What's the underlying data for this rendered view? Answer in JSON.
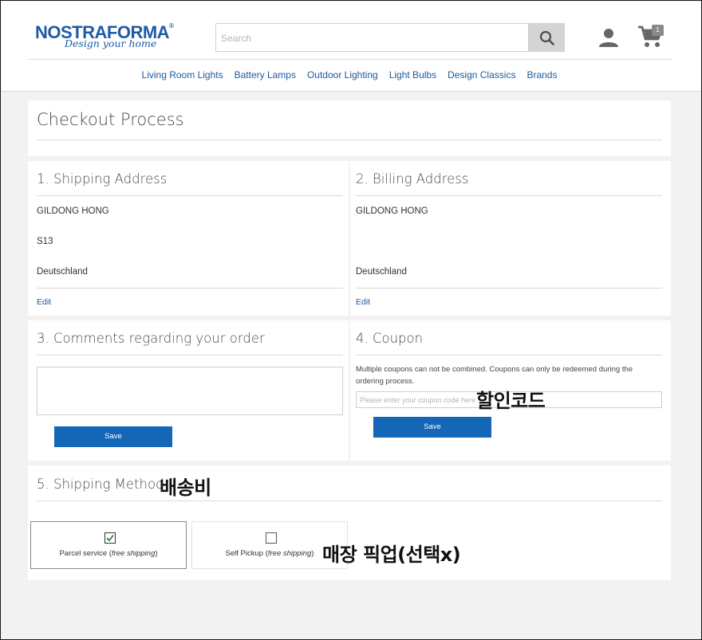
{
  "header": {
    "logo_main": "NOSTRAFORMA",
    "logo_tm": "®",
    "logo_tagline": "Design your home",
    "search_placeholder": "Search",
    "cart_count": "1",
    "icons": {
      "search": "search-icon",
      "user": "user-icon",
      "cart": "cart-icon"
    }
  },
  "nav": {
    "items": [
      {
        "label": "Living Room Lights"
      },
      {
        "label": "Battery Lamps"
      },
      {
        "label": "Outdoor Lighting"
      },
      {
        "label": "Light Bulbs"
      },
      {
        "label": "Design Classics"
      },
      {
        "label": "Brands"
      }
    ]
  },
  "page": {
    "title": "Checkout Process"
  },
  "shipping_address": {
    "title": "1. Shipping Address",
    "name": "GILDONG HONG",
    "line2": "S13",
    "country": "Deutschland",
    "edit_label": "Edit"
  },
  "billing_address": {
    "title": "2. Billing Address",
    "name": "GILDONG HONG",
    "country": "Deutschland",
    "edit_label": "Edit"
  },
  "comments": {
    "title": "3. Comments regarding your order",
    "value": "",
    "save_label": "Save"
  },
  "coupon": {
    "title": "4. Coupon",
    "note": "Multiple coupons can not be combined. Coupons can only be redeemed during the ordering process.",
    "placeholder": "Please enter your coupon code here",
    "save_label": "Save"
  },
  "shipping_method": {
    "title": "5. Shipping Method",
    "options": [
      {
        "label": "Parcel service",
        "note": "free shipping",
        "checked": true
      },
      {
        "label": "Self Pickup",
        "note": "free shipping",
        "checked": false
      }
    ]
  },
  "annotations": {
    "coupon_code": "할인코드",
    "shipping_fee": "배송비",
    "store_pickup": "매장 픽업(선택x)"
  },
  "colors": {
    "brand_blue": "#1e5aa8",
    "button_blue": "#1467b6",
    "link_blue": "#1a5b9e",
    "check_green": "#2e7d32"
  }
}
